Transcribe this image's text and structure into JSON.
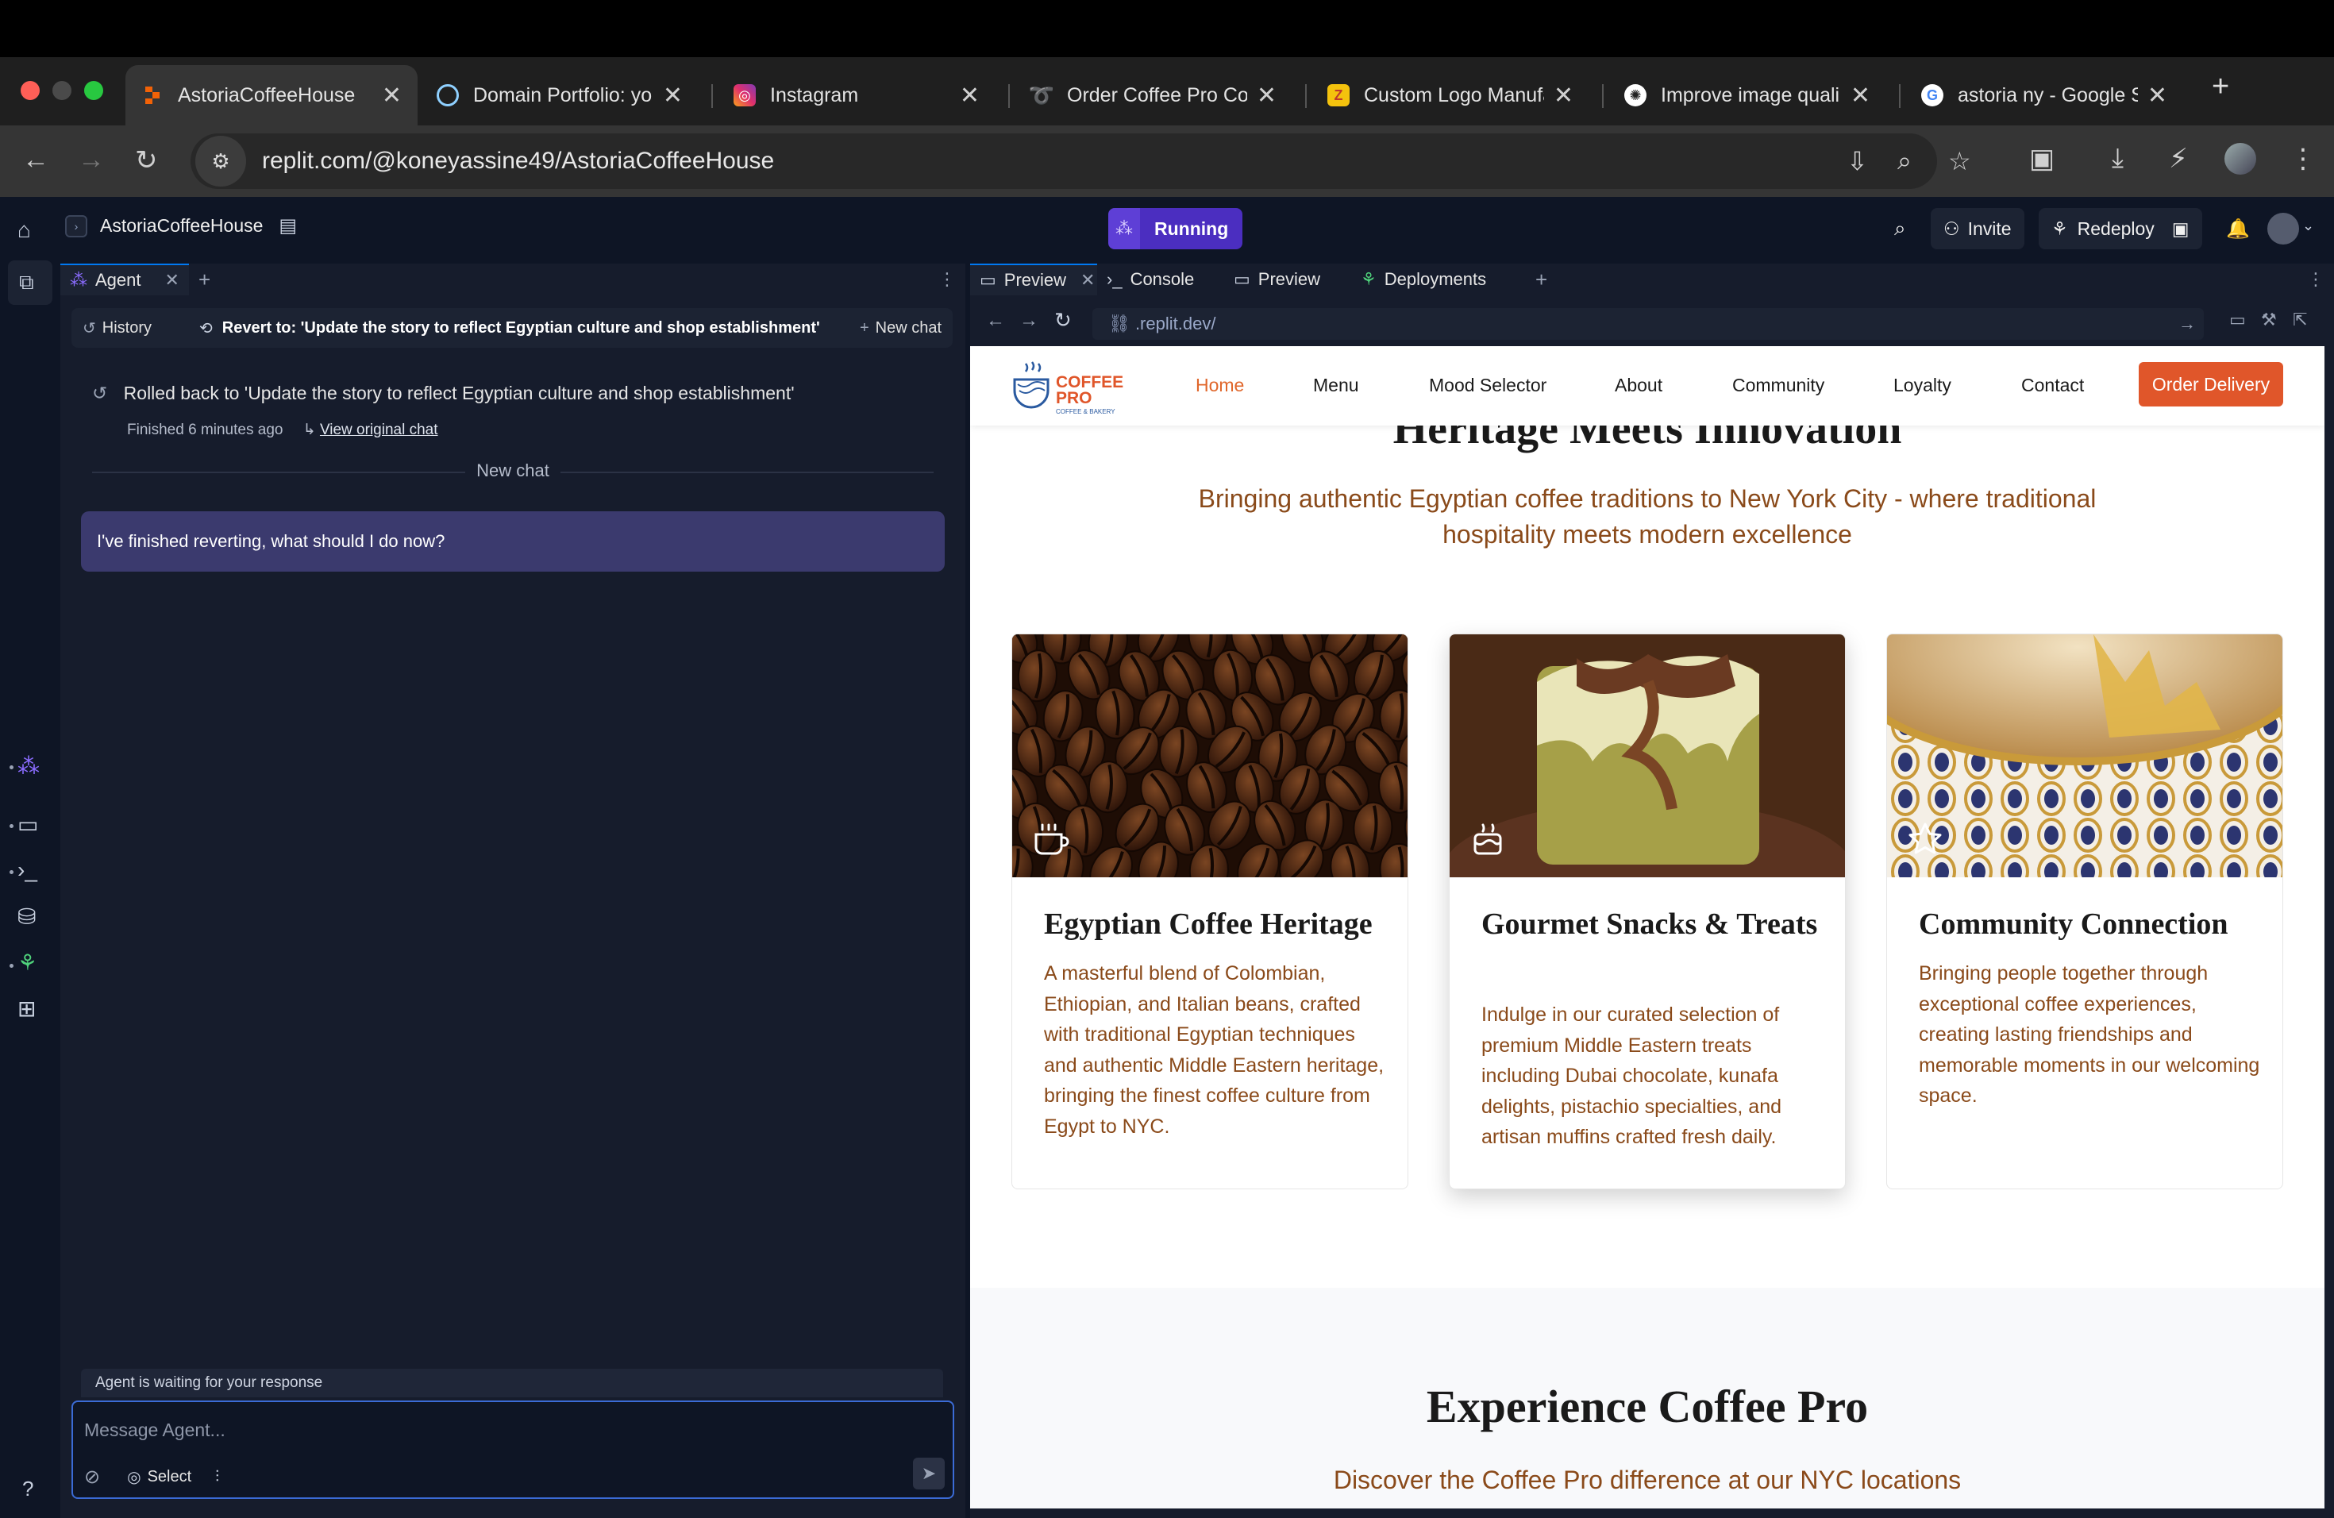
{
  "browser": {
    "tabs": [
      {
        "title": "AstoriaCoffeeHouse",
        "active": true
      },
      {
        "title": "Domain Portfolio: yo"
      },
      {
        "title": "Instagram"
      },
      {
        "title": "Order Coffee Pro Co"
      },
      {
        "title": "Custom Logo Manufa"
      },
      {
        "title": "Improve image quali"
      },
      {
        "title": "astoria ny - Google S"
      }
    ],
    "url": "replit.com/@koneyassine49/AstoriaCoffeeHouse"
  },
  "replit": {
    "project_name": "AstoriaCoffeeHouse",
    "run_status": "Running",
    "invite_label": "Invite",
    "redeploy_label": "Redeploy"
  },
  "agent": {
    "tab_label": "Agent",
    "history_label": "History",
    "revert_label": "Revert to: 'Update the story to reflect Egyptian culture and shop establishment'",
    "new_chat_btn": "New chat",
    "rolled_back": "Rolled back to 'Update the story to reflect Egyptian culture and shop establishment'",
    "finished": "Finished 6 minutes ago",
    "view_original": "View original chat",
    "new_chat_divider": "New chat",
    "user_message": "I've finished reverting, what should I do now?",
    "waiting": "Agent is waiting for your response",
    "input_placeholder": "Message Agent...",
    "select_label": "Select"
  },
  "preview": {
    "tabs": [
      "Preview",
      "Console",
      "Preview",
      "Deployments"
    ],
    "url_path": ".replit.dev/"
  },
  "site": {
    "logo_line1": "COFFEE",
    "logo_line2": "PRO",
    "logo_tag": "COFFEE & BAKERY",
    "nav": [
      "Home",
      "Menu",
      "Mood Selector",
      "About",
      "Community",
      "Loyalty",
      "Contact"
    ],
    "order_button": "Order Delivery",
    "hero_title": "Heritage Meets Innovation",
    "hero_subtitle": "Bringing authentic Egyptian coffee traditions to New York City - where traditional hospitality meets modern excellence",
    "cards": [
      {
        "title": "Egyptian Coffee Heritage",
        "icon": "coffee-cup-icon",
        "body": "A masterful blend of Colombian, Ethiopian, and Italian beans, crafted with traditional Egyptian techniques and authentic Middle Eastern heritage, bringing the finest coffee culture from Egypt to NYC."
      },
      {
        "title": "Gourmet Snacks & Treats",
        "icon": "cake-icon",
        "body": "Indulge in our curated selection of premium Middle Eastern treats including Dubai chocolate, kunafa delights, pistachio specialties, and artisan muffins crafted fresh daily."
      },
      {
        "title": "Community Connection",
        "icon": "star-icon",
        "body": "Bringing people together through exceptional coffee experiences, creating lasting friendships and memorable moments in our welcoming space."
      }
    ],
    "experience_title": "Experience Coffee Pro",
    "experience_subtitle": "Discover the Coffee Pro difference at our NYC locations"
  },
  "colors": {
    "accent": "#e0562a",
    "brown_text": "#8a4a1a",
    "replit_bg": "#0e1525",
    "running": "#4b2ec0"
  }
}
